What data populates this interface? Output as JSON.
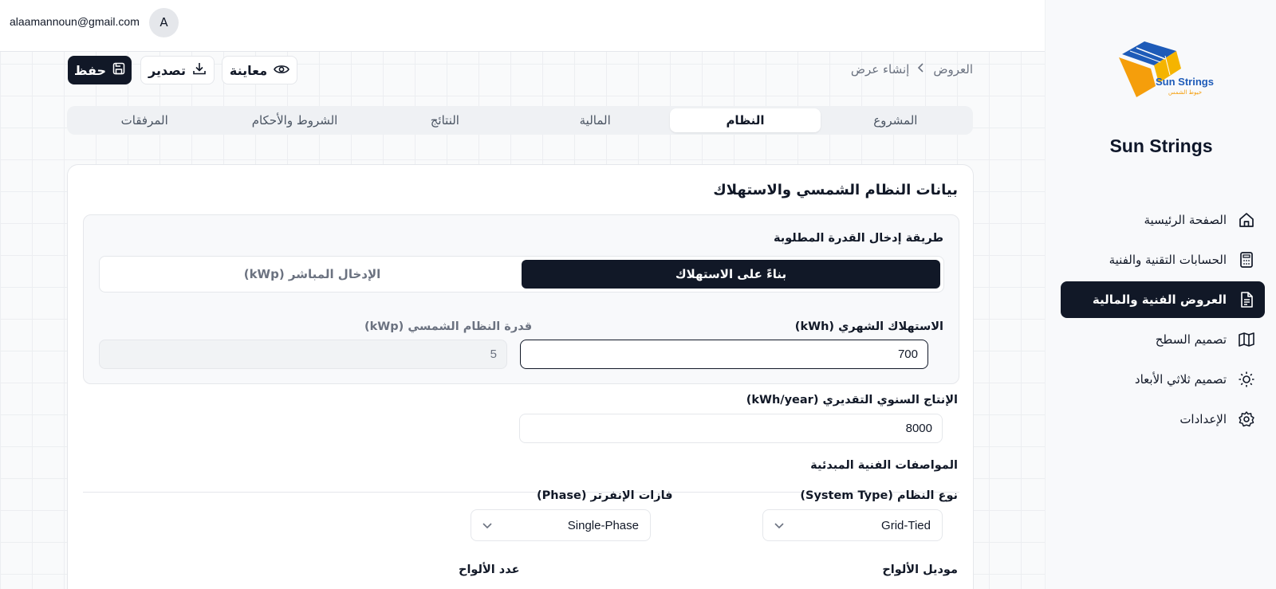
{
  "user": {
    "email": "alaamannoun@gmail.com",
    "avatar_initial": "A"
  },
  "sidebar": {
    "brand": "Sun Strings",
    "logo_text": "Sun Strings",
    "logo_arabic": "خيوط الشمس",
    "items": [
      {
        "label": "الصفحة الرئيسية",
        "icon": "home-icon",
        "active": false
      },
      {
        "label": "الحسابات التقنية والفنية",
        "icon": "calculator-icon",
        "active": false
      },
      {
        "label": "العروض الفنية والمالية",
        "icon": "document-icon",
        "active": true
      },
      {
        "label": "تصميم السطح",
        "icon": "map-icon",
        "active": false
      },
      {
        "label": "تصميم ثلاثي الأبعاد",
        "icon": "sun-icon",
        "active": false
      },
      {
        "label": "الإعدادات",
        "icon": "gear-icon",
        "active": false
      }
    ]
  },
  "breadcrumb": {
    "parent": "العروض",
    "current": "إنشاء عرض"
  },
  "toolbar": {
    "preview_label": "معاينة",
    "export_label": "تصدير",
    "save_label": "حفظ"
  },
  "tabs": [
    {
      "label": "المشروع",
      "active": false
    },
    {
      "label": "النظام",
      "active": true
    },
    {
      "label": "المالية",
      "active": false
    },
    {
      "label": "النتائج",
      "active": false
    },
    {
      "label": "الشروط والأحكام",
      "active": false
    },
    {
      "label": "المرفقات",
      "active": false
    }
  ],
  "form": {
    "title": "بيانات النظام الشمسي والاستهلاك",
    "input_method_label": "طريقة إدخال القدرة المطلوبة",
    "method_consumption": "بناءً على الاستهلاك",
    "method_direct": "الإدخال المباشر (kWp)",
    "monthly_consumption_label": "الاستهلاك الشهري (kWh)",
    "monthly_consumption_value": "700",
    "system_capacity_label": "قدرة النظام الشمسي (kWp)",
    "system_capacity_value": "5",
    "annual_production_label": "الإنتاج السنوي التقديري (kWh/year)",
    "annual_production_value": "8000",
    "specs_title": "المواصفات الفنية المبدئية",
    "system_type_label": "نوع النظام (System Type)",
    "system_type_value": "Grid-Tied",
    "inverter_phase_label": "فازات الإنفرتر (Phase)",
    "inverter_phase_value": "Single-Phase",
    "panel_model_label": "موديل الألواح",
    "panel_count_label": "عدد الألواح"
  },
  "colors": {
    "accent": "#111827",
    "logo_blue": "#1e5bb8",
    "logo_orange": "#f59e0b"
  }
}
